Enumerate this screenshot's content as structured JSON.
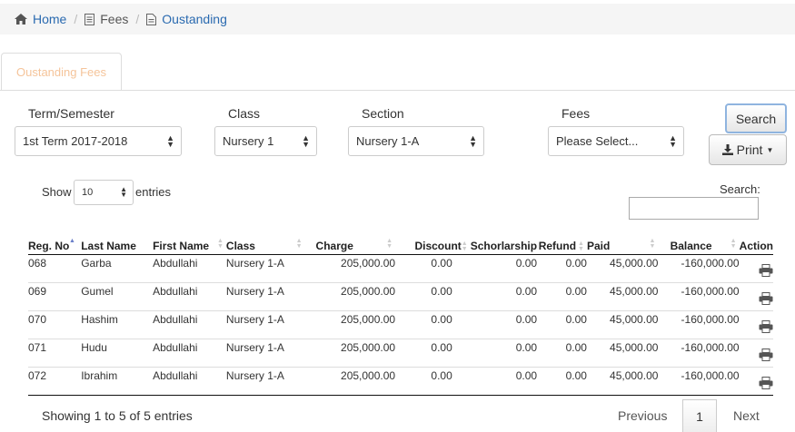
{
  "breadcrumb": {
    "home": "Home",
    "fees": "Fees",
    "current": "Oustanding"
  },
  "tab": {
    "label": "Oustanding Fees"
  },
  "filters": {
    "term_label": "Term/Semester",
    "term_value": "1st Term 2017-2018",
    "class_label": "Class",
    "class_value": "Nursery 1",
    "section_label": "Section",
    "section_value": "Nursery 1-A",
    "fees_label": "Fees",
    "fees_value": "Please Select..."
  },
  "buttons": {
    "search": "Search",
    "print": "Print"
  },
  "length": {
    "show": "Show",
    "value": "10",
    "entries": "entries"
  },
  "search": {
    "label": "Search:",
    "value": ""
  },
  "table": {
    "headers": [
      "Reg. No",
      "Last Name",
      "First Name",
      "Class",
      "Charge",
      "Discount",
      "Schorlarship",
      "Refund",
      "Paid",
      "Balance",
      "Action"
    ],
    "rows": [
      [
        "068",
        "Garba",
        "Abdullahi",
        "Nursery 1-A",
        "205,000.00",
        "0.00",
        "0.00",
        "0.00",
        "45,000.00",
        "-160,000.00"
      ],
      [
        "069",
        "Gumel",
        "Abdullahi",
        "Nursery 1-A",
        "205,000.00",
        "0.00",
        "0.00",
        "0.00",
        "45,000.00",
        "-160,000.00"
      ],
      [
        "070",
        "Hashim",
        "Abdullahi",
        "Nursery 1-A",
        "205,000.00",
        "0.00",
        "0.00",
        "0.00",
        "45,000.00",
        "-160,000.00"
      ],
      [
        "071",
        "Hudu",
        "Abdullahi",
        "Nursery 1-A",
        "205,000.00",
        "0.00",
        "0.00",
        "0.00",
        "45,000.00",
        "-160,000.00"
      ],
      [
        "072",
        "Ibrahim",
        "Abdullahi",
        "Nursery 1-A",
        "205,000.00",
        "0.00",
        "0.00",
        "0.00",
        "45,000.00",
        "-160,000.00"
      ]
    ]
  },
  "info": "Showing 1 to 5 of 5 entries",
  "pagination": {
    "previous": "Previous",
    "page": "1",
    "next": "Next"
  },
  "icons": {
    "home": "home-icon",
    "doc": "document-icon",
    "download": "download-icon",
    "printer": "printer-icon",
    "caret": "caret-down-icon"
  },
  "colors": {
    "link": "#2a6ab0",
    "tab_text": "#f5c49a",
    "search_focus": "#8fb4df"
  }
}
